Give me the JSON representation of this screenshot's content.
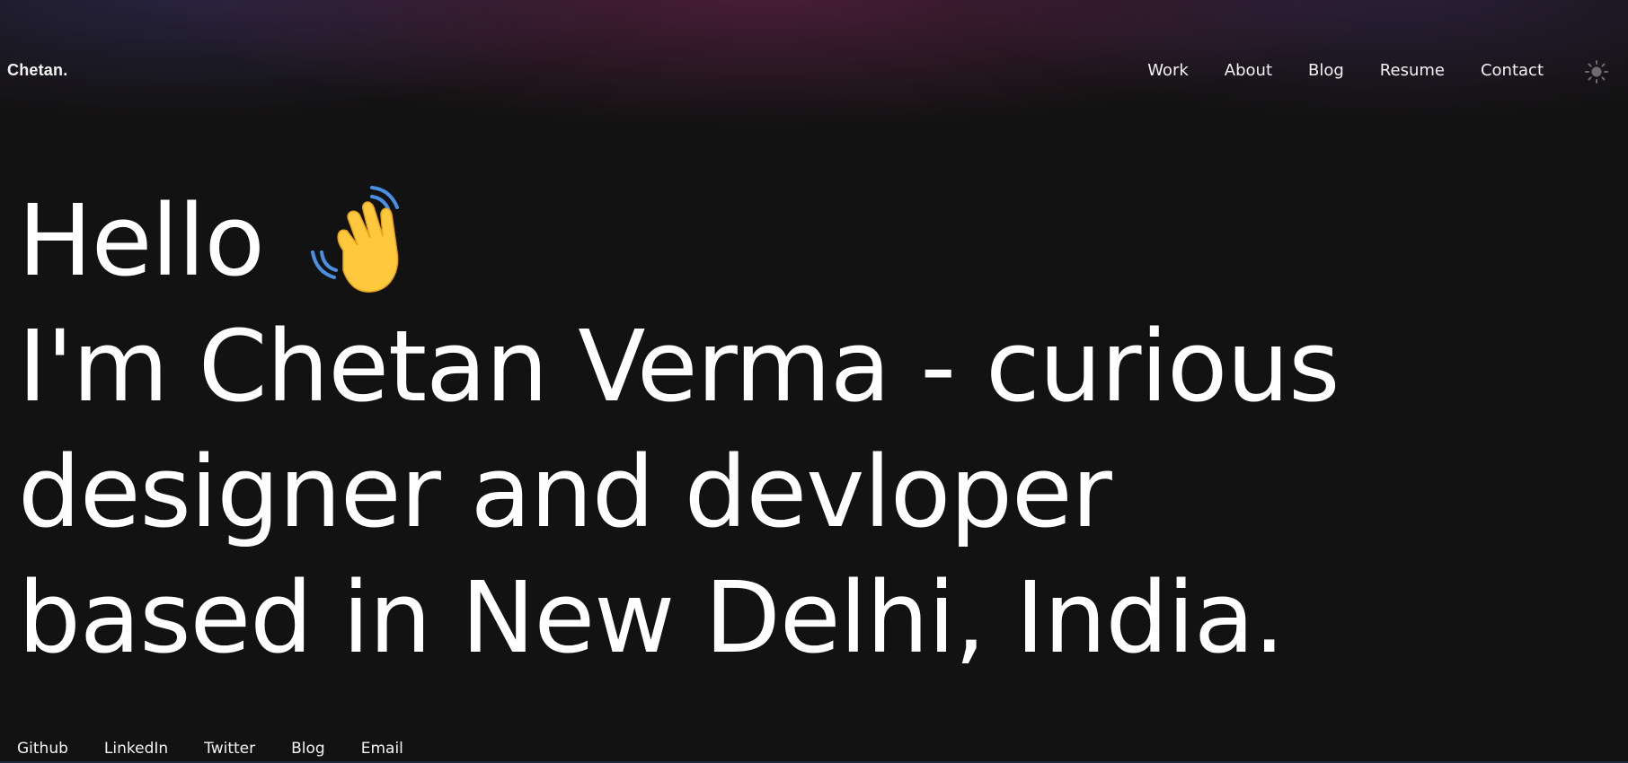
{
  "header": {
    "logo": "Chetan.",
    "nav": [
      {
        "label": "Work"
      },
      {
        "label": "About"
      },
      {
        "label": "Blog"
      },
      {
        "label": "Resume"
      },
      {
        "label": "Contact"
      }
    ],
    "theme_toggle_icon": "sun-icon"
  },
  "hero": {
    "greeting": "Hello",
    "greeting_icon": "waving-hand-icon",
    "lines": [
      "I'm Chetan Verma - curious",
      "designer and devloper",
      "based in New Delhi, India."
    ]
  },
  "socials": [
    {
      "label": "Github"
    },
    {
      "label": "LinkedIn"
    },
    {
      "label": "Twitter"
    },
    {
      "label": "Blog"
    },
    {
      "label": "Email"
    }
  ],
  "colors": {
    "background": "#131212",
    "text": "#ffffff",
    "wave_yellow": "#ffc83d",
    "wave_lines": "#4a90e2"
  }
}
